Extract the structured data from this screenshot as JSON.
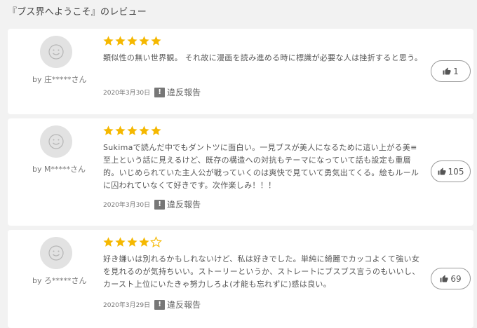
{
  "page": {
    "title": "『ブス界へようこそ』のレビュー"
  },
  "colors": {
    "star": "#f5b800",
    "star_empty": "#f5b800",
    "card_bg": "#ffffff",
    "page_bg": "#f2f2f2"
  },
  "reviews": [
    {
      "reviewer": "by 庄*****さん",
      "rating": 5,
      "text": "類似性の無い世界観。 それ故に漫画を読み進める時に標識が必要な人は挫折すると思う。",
      "date": "2020年3月30日",
      "report_label": "違反報告",
      "likes": "1"
    },
    {
      "reviewer": "by M*****さん",
      "rating": 5,
      "text": "Sukimaで読んだ中でもダントツに面白い。一見ブスが美人になるために這い上がる美≡至上という話に見えるけど、既存の構造への対抗もテーマになっていて話も設定も重層的。いじめられていた主人公が戦っていくのは爽快で見ていて勇気出てくる。絵もルールに囚われていなくて好きです。次作楽しみ！！！",
      "date": "2020年3月30日",
      "report_label": "違反報告",
      "likes": "105"
    },
    {
      "reviewer": "by ろ*****さん",
      "rating": 4,
      "text": "好き嫌いは別れるかもしれないけど、私は好きでした。単純に綺麗でカッコよくて強い女を見れるのが気持ちいい。ストーリーというか、ストレートにブスブス言うのもいいし、カースト上位にいたきゃ努力しろよ(才能も忘れずに)感は良い。",
      "date": "2020年3月29日",
      "report_label": "違反報告",
      "likes": "69"
    }
  ],
  "icons": {
    "avatar": "smiley-face-icon",
    "star": "star-icon",
    "report": "report-icon",
    "like": "thumbs-up-icon"
  }
}
